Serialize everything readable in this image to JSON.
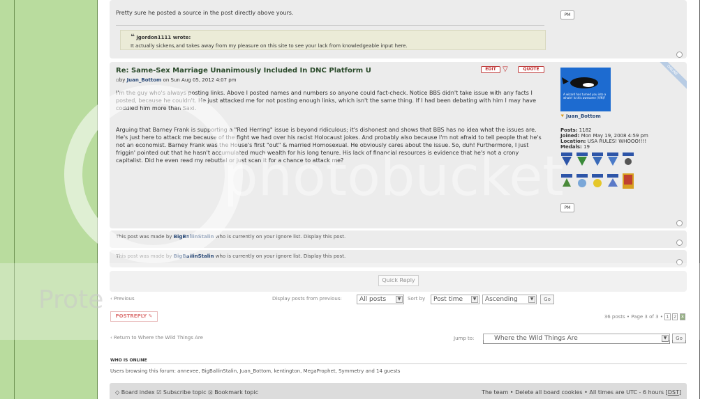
{
  "top_post": {
    "body": "Pretty sure he posted a source in the post directly above yours.",
    "quote_author": "jgordon1111 wrote:",
    "quote_text": "It actually sickens,and takes away from my pleasure on this site to see your lack from knowledgeable input here."
  },
  "post": {
    "title": "Re: Same-Sex Marriage Unanimously Included In DNC Platform U",
    "by": "by",
    "author": "Juan_Bottom",
    "date": "on Sun Aug 05, 2012 4:07 pm",
    "edit_label": "EDIT",
    "quote_label": "QUOTE",
    "para1": "I'm the guy who's always posting links. Above I posted names and numbers so anyone could fact-check. Notice BBS didn't take issue with any facts I posted, because he couldn't. He just attacked me for not posting enough links, which isn't the same thing. If I had been debating with him I may have coddled him more than Saxi.",
    "para2": "Arguing that Barney Frank is supporting a \"Red Herring\" issue is beyond ridiculous; it's dishonest and shows that BBS has no idea what the issues are. He's just here to attack me because of the fight we had over his racist Holocaust jokes. And probably also because I'm not afraid to tell people that he's not an economist. Barney Frank was the House's first \"out\" & married Homosexual. He obviously cares about the issue. So, duh! Furthermore, I just friggin' pointed out that he hasn't accumulated much wealth for his long tenure. His lack of financial resources is evidence that he's not a crony capitalist. Did he even read my rebuttal or just scan it for a chance to attack me?",
    "online_label": "ONLINE",
    "avatar_text": "A wizard has turned you into a whale! Is this awesome (Y/N)?",
    "profile_name": "Juan_Bottom",
    "posts_label": "Posts:",
    "posts": "1182",
    "joined_label": "Joined:",
    "joined": "Mon May 19, 2008 4:59 pm",
    "location_label": "Location:",
    "location": "USA RULES! WHOOO!!!!",
    "medals_label": "Medals:",
    "medals": "19",
    "pm_label": "PM"
  },
  "ignored": [
    {
      "pre": "This post was made by ",
      "user": "BigBallinStalin",
      "post": " who is currently on your ignore list. Display this post."
    },
    {
      "pre": "This post was made by ",
      "user": "BigBallinStalin",
      "post": " who is currently on your ignore list. Display this post."
    }
  ],
  "quick_reply": "Quick Reply",
  "nav": {
    "previous": "Previous",
    "display_label": "Display posts from previous:",
    "display_value": "All posts",
    "sort_label": "Sort by",
    "sort_value": "Post time",
    "order_value": "Ascending",
    "go": "Go"
  },
  "postreply": "POSTREPLY",
  "pagination": {
    "count": "36 posts",
    "page_text": "Page 3 of 3",
    "pages": [
      "1",
      "2",
      "3"
    ]
  },
  "return_link": "Return to Where the Wild Things Are",
  "jump": {
    "label": "Jump to:",
    "value": "Where the Wild Things Are",
    "go": "Go"
  },
  "online": {
    "heading": "WHO IS ONLINE",
    "text": "Users browsing this forum: annevee, BigBallinStalin, Juan_Bottom, kentington, MegaProphet, Symmetry and 14 guests"
  },
  "footer": {
    "board_index": "Board index",
    "subscribe": "Subscribe topic",
    "bookmark": "Bookmark topic",
    "team": "The team",
    "delete_cookies": "Delete all board cookies",
    "timezone": "All times are UTC - 6 hours [",
    "dst": "DST",
    "tz_end": "]"
  },
  "watermark": {
    "left_text": "Prote",
    "center_text": "photobucket"
  },
  "colors": {
    "sidebar": "#b9dc9e",
    "panel": "#ececec",
    "quote_bg": "#ebebd7",
    "avatar_blue": "#1d6bd0",
    "accent_red": "#c03030"
  }
}
